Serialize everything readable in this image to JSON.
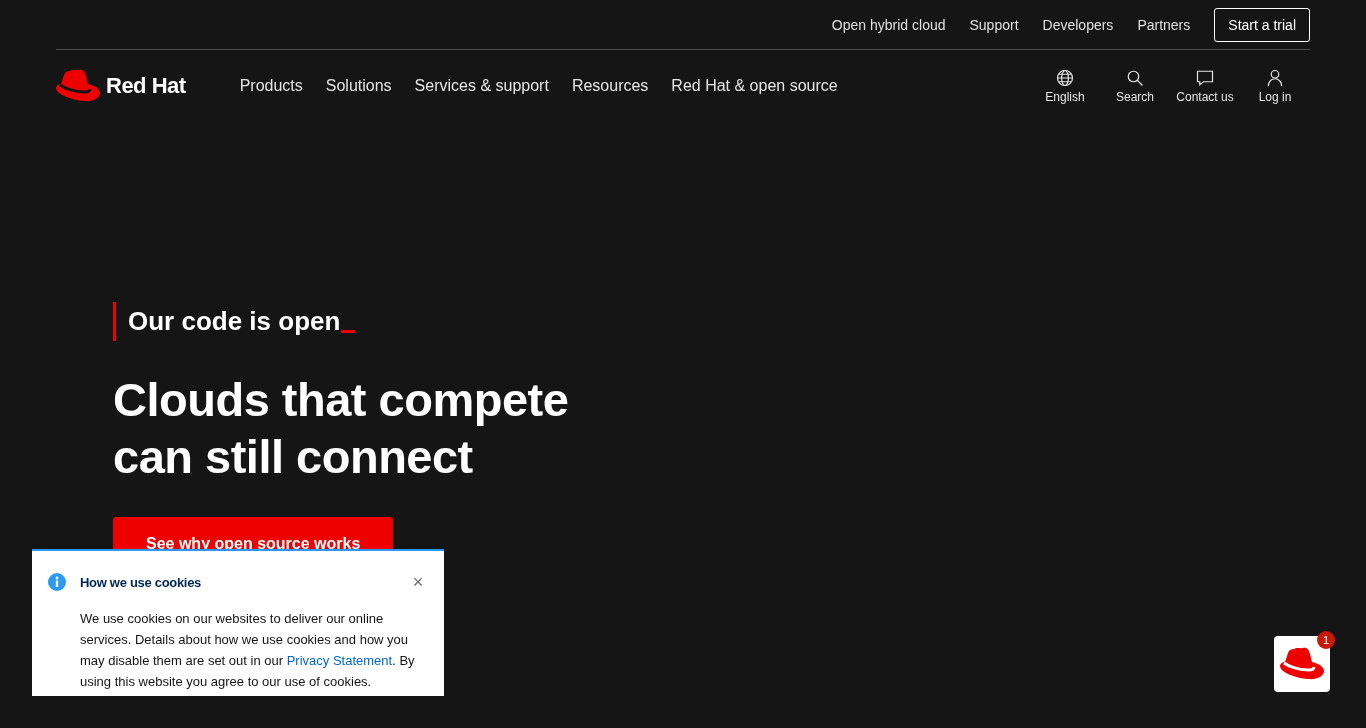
{
  "utility_nav": {
    "links": [
      "Open hybrid cloud",
      "Support",
      "Developers",
      "Partners"
    ],
    "cta": "Start a trial"
  },
  "main_nav": {
    "logo_text": "Red Hat",
    "items": [
      "Products",
      "Solutions",
      "Services & support",
      "Resources",
      "Red Hat & open source"
    ],
    "actions": [
      {
        "kind": "globe",
        "label": "English"
      },
      {
        "kind": "search",
        "label": "Search"
      },
      {
        "kind": "chat",
        "label": "Contact us"
      },
      {
        "kind": "user",
        "label": "Log in"
      }
    ]
  },
  "hero": {
    "eyebrow": "Our code is open",
    "title_lines": [
      "Clouds that compete",
      "can still connect"
    ],
    "button": "See why open source works"
  },
  "cookie_notice": {
    "title": "How we use cookies",
    "text_before": "We use cookies on our websites to deliver our online services. Details about how we use cookies and how you may disable them are set out in our ",
    "link": "Privacy Statement",
    "text_after": ". By using this website you agree to our use of cookies.",
    "close": "×"
  },
  "chat_widget": {
    "badge": "1"
  }
}
